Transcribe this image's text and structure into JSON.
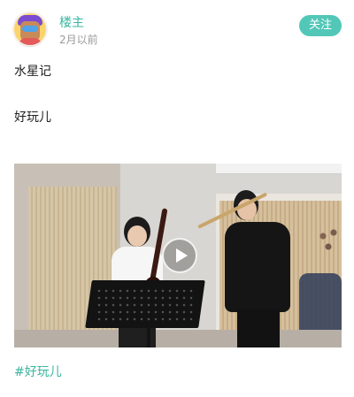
{
  "post": {
    "author": "楼主",
    "time": "2月以前",
    "follow_label": "关注",
    "text_lines": [
      "水星记",
      "好玩儿"
    ],
    "tag": "#好玩儿"
  },
  "icons": {
    "avatar": "astronaut-avatar-icon",
    "play": "play-icon"
  },
  "colors": {
    "accent": "#52c7b8",
    "accent_text": "#3ab5a0",
    "muted": "#9a9a9a"
  }
}
